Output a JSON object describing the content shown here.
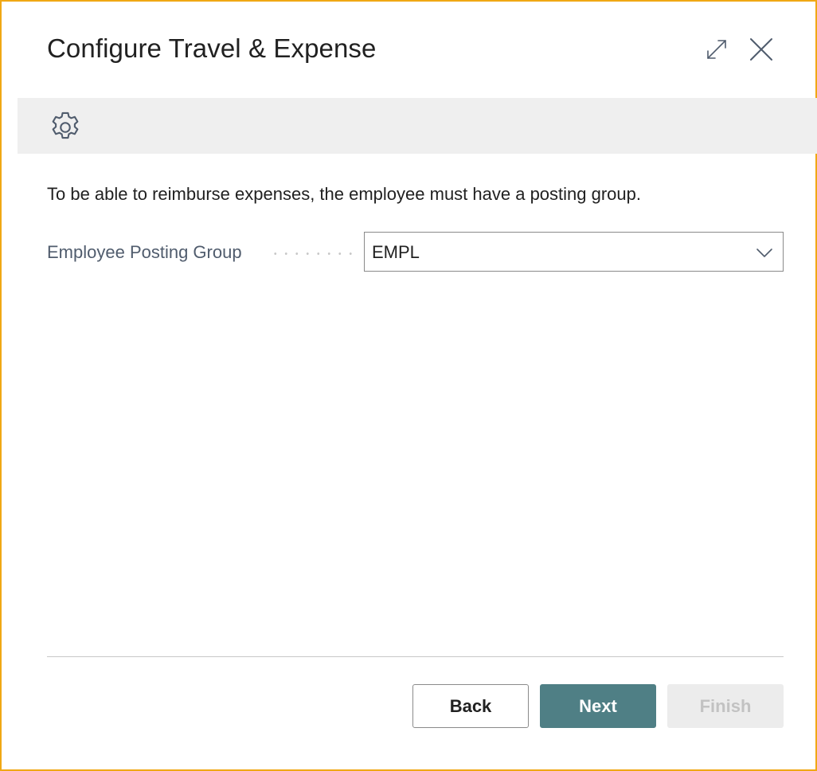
{
  "dialog": {
    "title": "Configure Travel & Expense",
    "expand_icon": "expand-diagonal-icon",
    "close_icon": "close-icon"
  },
  "toolbar": {
    "icon": "gear-icon"
  },
  "content": {
    "instruction": "To be able to reimburse expenses, the employee must have a posting group.",
    "fields": [
      {
        "label": "Employee Posting Group",
        "value": "EMPL"
      }
    ]
  },
  "footer": {
    "back_label": "Back",
    "next_label": "Next",
    "finish_label": "Finish"
  },
  "colors": {
    "frame_border": "#f0a814",
    "toolbar_background": "#efefef",
    "primary_button": "#4f7f85",
    "disabled_button": "#ececec",
    "label_text": "#505c6d"
  }
}
